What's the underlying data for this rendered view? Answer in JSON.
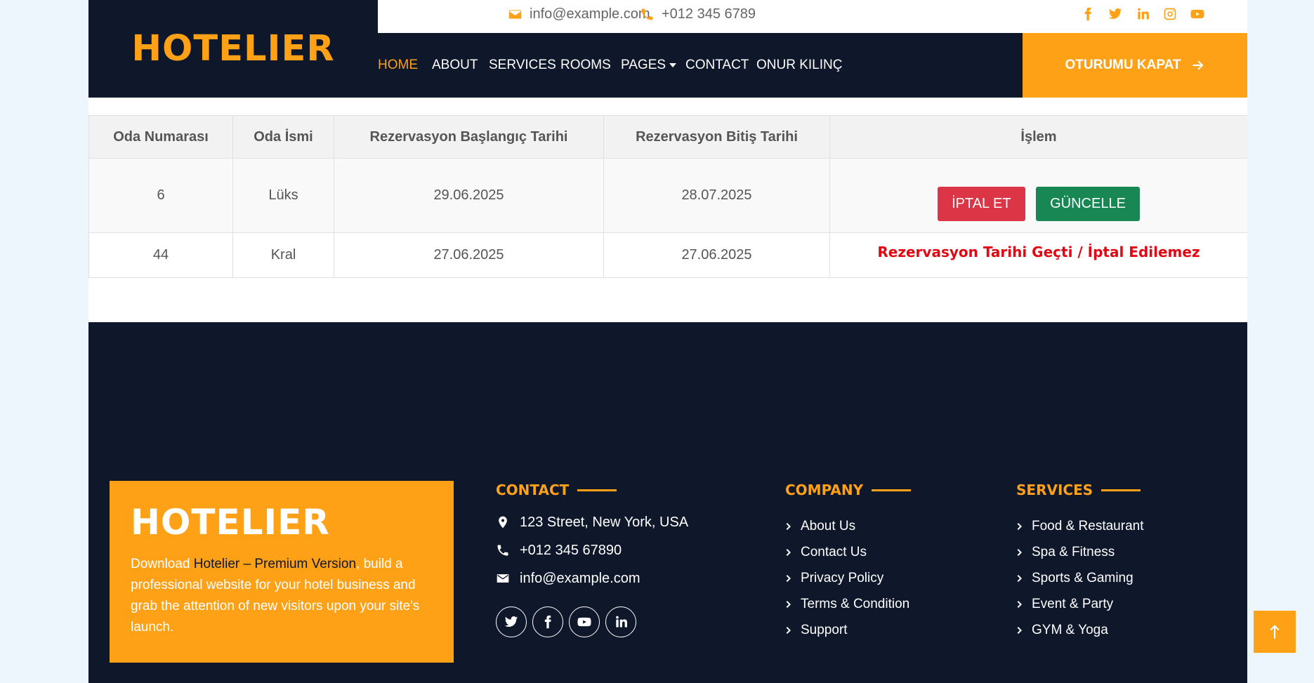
{
  "brand": {
    "name": "HOTELIER"
  },
  "topbar": {
    "email": "info@example.com",
    "phone": "+012 345 6789",
    "socials": [
      "facebook-icon",
      "twitter-icon",
      "linkedin-icon",
      "instagram-icon",
      "youtube-icon"
    ]
  },
  "nav": {
    "items": [
      {
        "label": "HOME",
        "active": true
      },
      {
        "label": "ABOUT"
      },
      {
        "label": "SERVICES"
      },
      {
        "label": "ROOMS"
      },
      {
        "label": "PAGES"
      },
      {
        "label": "CONTACT"
      },
      {
        "label": "ONUR KILINÇ"
      }
    ],
    "logout_label": "OTURUMU KAPAT"
  },
  "table": {
    "headers": [
      "Oda Numarası",
      "Oda İsmi",
      "Rezervasyon Başlangıç Tarihi",
      "Rezervasyon Bitiş Tarihi",
      "İşlem"
    ],
    "rows": [
      {
        "room_no": "6",
        "room_name": "Lüks",
        "start": "29.06.2025",
        "end": "28.07.2025",
        "cancel_label": "İPTAL ET",
        "update_label": "GÜNCELLE"
      },
      {
        "room_no": "44",
        "room_name": "Kral",
        "start": "27.06.2025",
        "end": "27.06.2025",
        "notice": "Rezervasyon Tarihi Geçti / İptal Edilemez"
      }
    ]
  },
  "footer": {
    "promo": {
      "title": "HOTELIER",
      "text_before": "Download ",
      "highlight": "Hotelier – Premium Version",
      "text_after": ", build a professional website for your hotel business and grab the attention of new visitors upon your site's launch."
    },
    "contact": {
      "heading": "CONTACT",
      "address": "123 Street, New York, USA",
      "phone": "+012 345 67890",
      "email": "info@example.com"
    },
    "company": {
      "heading": "COMPANY",
      "links": [
        "About Us",
        "Contact Us",
        "Privacy Policy",
        "Terms & Condition",
        "Support"
      ]
    },
    "services": {
      "heading": "SERVICES",
      "links": [
        "Food & Restaurant",
        "Spa & Fitness",
        "Sports & Gaming",
        "Event & Party",
        "GYM & Yoga"
      ]
    }
  },
  "colors": {
    "primary": "#FEA116",
    "dark": "#0F172B",
    "danger": "#DC3545",
    "success": "#198754",
    "warning_text": "#E30613"
  }
}
